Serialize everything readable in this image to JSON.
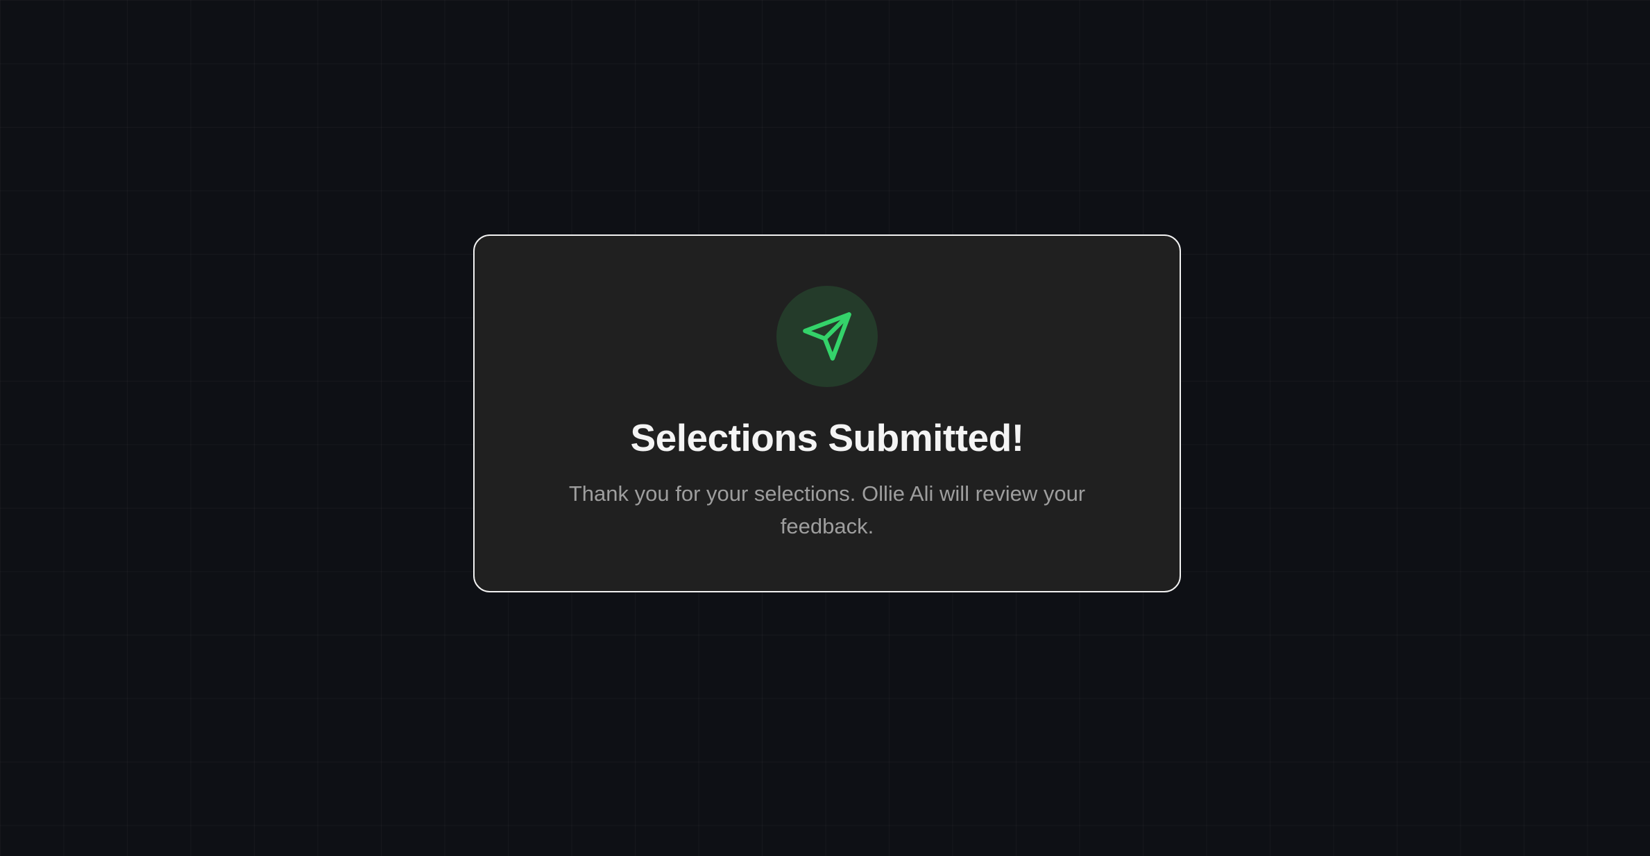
{
  "dialog": {
    "icon": "send-icon",
    "accent_color": "#34d36a",
    "icon_bg_color": "#243b2a",
    "title": "Selections Submitted!",
    "message": "Thank you for your selections. Ollie Ali will review your feedback."
  }
}
